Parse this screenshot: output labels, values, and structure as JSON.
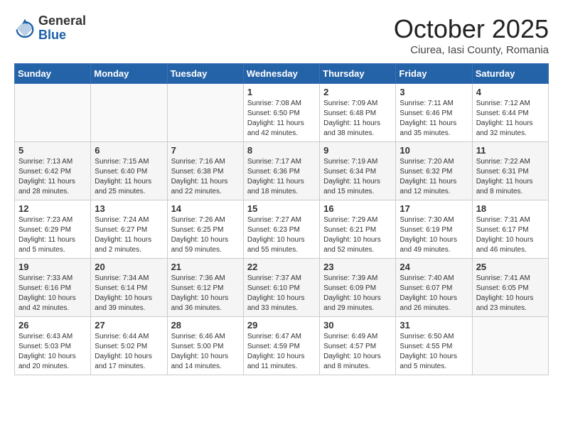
{
  "logo": {
    "general": "General",
    "blue": "Blue"
  },
  "title": "October 2025",
  "subtitle": "Ciurea, Iasi County, Romania",
  "days_header": [
    "Sunday",
    "Monday",
    "Tuesday",
    "Wednesday",
    "Thursday",
    "Friday",
    "Saturday"
  ],
  "weeks": [
    [
      {
        "day": "",
        "info": ""
      },
      {
        "day": "",
        "info": ""
      },
      {
        "day": "",
        "info": ""
      },
      {
        "day": "1",
        "info": "Sunrise: 7:08 AM\nSunset: 6:50 PM\nDaylight: 11 hours\nand 42 minutes."
      },
      {
        "day": "2",
        "info": "Sunrise: 7:09 AM\nSunset: 6:48 PM\nDaylight: 11 hours\nand 38 minutes."
      },
      {
        "day": "3",
        "info": "Sunrise: 7:11 AM\nSunset: 6:46 PM\nDaylight: 11 hours\nand 35 minutes."
      },
      {
        "day": "4",
        "info": "Sunrise: 7:12 AM\nSunset: 6:44 PM\nDaylight: 11 hours\nand 32 minutes."
      }
    ],
    [
      {
        "day": "5",
        "info": "Sunrise: 7:13 AM\nSunset: 6:42 PM\nDaylight: 11 hours\nand 28 minutes."
      },
      {
        "day": "6",
        "info": "Sunrise: 7:15 AM\nSunset: 6:40 PM\nDaylight: 11 hours\nand 25 minutes."
      },
      {
        "day": "7",
        "info": "Sunrise: 7:16 AM\nSunset: 6:38 PM\nDaylight: 11 hours\nand 22 minutes."
      },
      {
        "day": "8",
        "info": "Sunrise: 7:17 AM\nSunset: 6:36 PM\nDaylight: 11 hours\nand 18 minutes."
      },
      {
        "day": "9",
        "info": "Sunrise: 7:19 AM\nSunset: 6:34 PM\nDaylight: 11 hours\nand 15 minutes."
      },
      {
        "day": "10",
        "info": "Sunrise: 7:20 AM\nSunset: 6:32 PM\nDaylight: 11 hours\nand 12 minutes."
      },
      {
        "day": "11",
        "info": "Sunrise: 7:22 AM\nSunset: 6:31 PM\nDaylight: 11 hours\nand 8 minutes."
      }
    ],
    [
      {
        "day": "12",
        "info": "Sunrise: 7:23 AM\nSunset: 6:29 PM\nDaylight: 11 hours\nand 5 minutes."
      },
      {
        "day": "13",
        "info": "Sunrise: 7:24 AM\nSunset: 6:27 PM\nDaylight: 11 hours\nand 2 minutes."
      },
      {
        "day": "14",
        "info": "Sunrise: 7:26 AM\nSunset: 6:25 PM\nDaylight: 10 hours\nand 59 minutes."
      },
      {
        "day": "15",
        "info": "Sunrise: 7:27 AM\nSunset: 6:23 PM\nDaylight: 10 hours\nand 55 minutes."
      },
      {
        "day": "16",
        "info": "Sunrise: 7:29 AM\nSunset: 6:21 PM\nDaylight: 10 hours\nand 52 minutes."
      },
      {
        "day": "17",
        "info": "Sunrise: 7:30 AM\nSunset: 6:19 PM\nDaylight: 10 hours\nand 49 minutes."
      },
      {
        "day": "18",
        "info": "Sunrise: 7:31 AM\nSunset: 6:17 PM\nDaylight: 10 hours\nand 46 minutes."
      }
    ],
    [
      {
        "day": "19",
        "info": "Sunrise: 7:33 AM\nSunset: 6:16 PM\nDaylight: 10 hours\nand 42 minutes."
      },
      {
        "day": "20",
        "info": "Sunrise: 7:34 AM\nSunset: 6:14 PM\nDaylight: 10 hours\nand 39 minutes."
      },
      {
        "day": "21",
        "info": "Sunrise: 7:36 AM\nSunset: 6:12 PM\nDaylight: 10 hours\nand 36 minutes."
      },
      {
        "day": "22",
        "info": "Sunrise: 7:37 AM\nSunset: 6:10 PM\nDaylight: 10 hours\nand 33 minutes."
      },
      {
        "day": "23",
        "info": "Sunrise: 7:39 AM\nSunset: 6:09 PM\nDaylight: 10 hours\nand 29 minutes."
      },
      {
        "day": "24",
        "info": "Sunrise: 7:40 AM\nSunset: 6:07 PM\nDaylight: 10 hours\nand 26 minutes."
      },
      {
        "day": "25",
        "info": "Sunrise: 7:41 AM\nSunset: 6:05 PM\nDaylight: 10 hours\nand 23 minutes."
      }
    ],
    [
      {
        "day": "26",
        "info": "Sunrise: 6:43 AM\nSunset: 5:03 PM\nDaylight: 10 hours\nand 20 minutes."
      },
      {
        "day": "27",
        "info": "Sunrise: 6:44 AM\nSunset: 5:02 PM\nDaylight: 10 hours\nand 17 minutes."
      },
      {
        "day": "28",
        "info": "Sunrise: 6:46 AM\nSunset: 5:00 PM\nDaylight: 10 hours\nand 14 minutes."
      },
      {
        "day": "29",
        "info": "Sunrise: 6:47 AM\nSunset: 4:59 PM\nDaylight: 10 hours\nand 11 minutes."
      },
      {
        "day": "30",
        "info": "Sunrise: 6:49 AM\nSunset: 4:57 PM\nDaylight: 10 hours\nand 8 minutes."
      },
      {
        "day": "31",
        "info": "Sunrise: 6:50 AM\nSunset: 4:55 PM\nDaylight: 10 hours\nand 5 minutes."
      },
      {
        "day": "",
        "info": ""
      }
    ]
  ]
}
